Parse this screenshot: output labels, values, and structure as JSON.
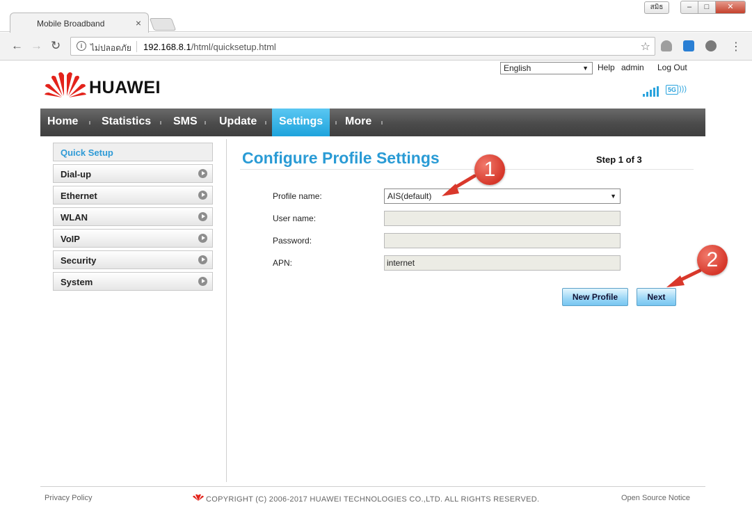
{
  "browser": {
    "tab_title": "Mobile Broadband",
    "tab_close": "×",
    "window_user": "สมิธ",
    "window_controls": {
      "minimize": "–",
      "maximize": "□",
      "close": "✕"
    },
    "nav": {
      "back": "←",
      "forward": "→",
      "reload": "↻"
    },
    "security_label": "ไม่ปลอดภัย",
    "url_host": "192.168.8.1",
    "url_path": "/html/quicksetup.html",
    "menu_icon": "⋮"
  },
  "header": {
    "language": "English",
    "links": {
      "help": "Help",
      "user": "admin",
      "logout": "Log Out"
    },
    "brand": "HUAWEI",
    "network": "5G",
    "logo_color": "#e3231b",
    "accent_color": "#2a9bd5"
  },
  "menu": {
    "items": [
      {
        "label": "Home"
      },
      {
        "label": "Statistics"
      },
      {
        "label": "SMS"
      },
      {
        "label": "Update"
      },
      {
        "label": "Settings",
        "active": true
      },
      {
        "label": "More"
      }
    ]
  },
  "sidebar": {
    "items": [
      {
        "label": "Quick Setup",
        "active": true
      },
      {
        "label": "Dial-up"
      },
      {
        "label": "Ethernet"
      },
      {
        "label": "WLAN"
      },
      {
        "label": "VoIP"
      },
      {
        "label": "Security"
      },
      {
        "label": "System"
      }
    ]
  },
  "content": {
    "title": "Configure Profile Settings",
    "step": "Step 1 of 3",
    "fields": {
      "profile_label": "Profile name:",
      "profile_value": "AIS(default)",
      "username_label": "User name:",
      "username_value": "",
      "password_label": "Password:",
      "password_value": "",
      "apn_label": "APN:",
      "apn_value": "internet"
    },
    "buttons": {
      "new_profile": "New Profile",
      "next": "Next"
    }
  },
  "annotations": {
    "badge1": "1",
    "badge2": "2"
  },
  "footer": {
    "privacy": "Privacy Policy",
    "copyright": "COPYRIGHT (C) 2006-2017 HUAWEI TECHNOLOGIES CO.,LTD. ALL RIGHTS RESERVED.",
    "open_source": "Open Source Notice"
  }
}
